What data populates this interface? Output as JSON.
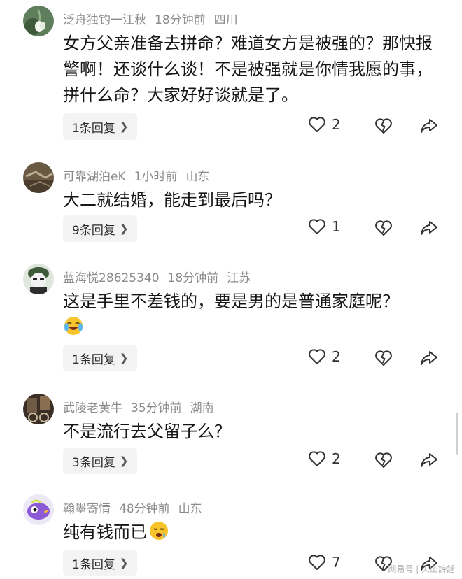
{
  "comments": [
    {
      "username": "泛舟独钓一江秋",
      "time": "18分钟前",
      "location": "四川",
      "text": "女方父亲准备去拼命？难道女方是被强的？那快报警啊！还谈什么谈！不是被强就是你情我愿的事，拼什么命？大家好好谈就是了。",
      "reply_label": "1条回复",
      "likes": "2",
      "avatar": "snowdrop-flower"
    },
    {
      "username": "可靠湖泊eK",
      "time": "1小时前",
      "location": "山东",
      "text": "大二就结婚，能走到最后吗？",
      "reply_label": "9条回复",
      "likes": "1",
      "avatar": "brown-landscape"
    },
    {
      "username": "蓝海悦28625340",
      "time": "18分钟前",
      "location": "江苏",
      "text": "这是手里不差钱的，要是男的是普通家庭呢？",
      "reply_label": "1条回复",
      "likes": "2",
      "avatar": "cartoon-soldier"
    },
    {
      "username": "武陵老黄牛",
      "time": "35分钟前",
      "location": "湖南",
      "text": "不是流行去父留子么？",
      "reply_label": "3条回复",
      "likes": "2",
      "avatar": "street-photo"
    },
    {
      "username": "翰墨寄情",
      "time": "48分钟前",
      "location": "山东",
      "text": "纯有钱而已",
      "reply_label": "1条回复",
      "likes": "7",
      "avatar": "purple-bird"
    }
  ],
  "watermark": "网易号 | 火山詩話",
  "colors": {
    "meta_text": "#8b8b8b",
    "body_text": "#161616",
    "reply_bg": "#f3f3f3"
  }
}
